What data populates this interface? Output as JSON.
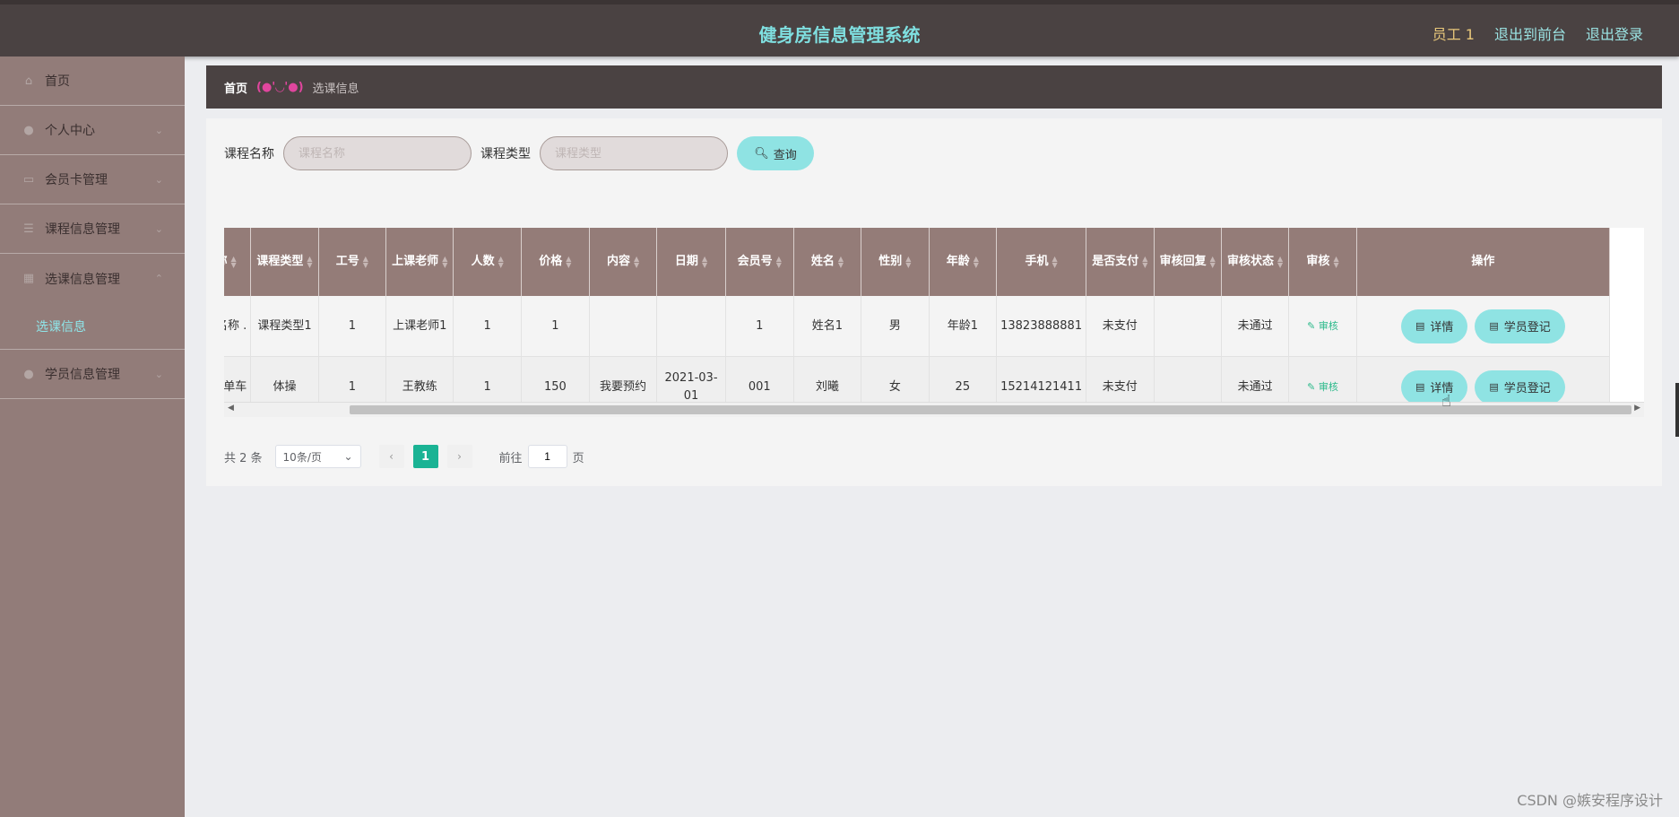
{
  "header": {
    "title": "健身房信息管理系统",
    "user": "员工 1",
    "to_front": "退出到前台",
    "logout": "退出登录"
  },
  "sidebar": {
    "items": [
      {
        "label": "首页",
        "icon": "home-icon"
      },
      {
        "label": "个人中心",
        "icon": "user-icon"
      },
      {
        "label": "会员卡管理",
        "icon": "card-icon"
      },
      {
        "label": "课程信息管理",
        "icon": "list-icon"
      },
      {
        "label": "选课信息管理",
        "icon": "grid-icon"
      },
      {
        "label": "学员信息管理",
        "icon": "user-icon"
      }
    ],
    "sub_item": "选课信息"
  },
  "breadcrumb": {
    "home": "首页",
    "sep": "(●'◡'●)",
    "current": "选课信息"
  },
  "search": {
    "name_label": "课程名称",
    "name_placeholder": "课程名称",
    "type_label": "课程类型",
    "type_placeholder": "课程类型",
    "button": "查询"
  },
  "table": {
    "headers": [
      "名称",
      "课程类型",
      "工号",
      "上课老师",
      "人数",
      "价格",
      "内容",
      "日期",
      "会员号",
      "姓名",
      "性别",
      "年龄",
      "手机",
      "是否支付",
      "审核回复",
      "审核状态",
      "审核",
      "操作"
    ],
    "rows": [
      [
        "名称 .",
        "课程类型1",
        "1",
        "上课老师1",
        "1",
        "1",
        "",
        "",
        "1",
        "姓名1",
        "男",
        "年龄1",
        "13823888881",
        "未支付",
        "",
        "未通过",
        "审核",
        ""
      ],
      [
        "单车",
        "体操",
        "1",
        "王教练",
        "1",
        "150",
        "我要预约",
        "2021-03-01",
        "001",
        "刘曦",
        "女",
        "25",
        "15214121411",
        "未支付",
        "",
        "未通过",
        "审核",
        ""
      ]
    ],
    "detail_btn": "详情",
    "register_btn": "学员登记"
  },
  "pager": {
    "total": "共 2 条",
    "page_size": "10条/页",
    "current_page": "1",
    "goto_label": "前往",
    "goto_value": "1",
    "page_unit": "页"
  },
  "watermark": "CSDN @嫉安程序设计"
}
